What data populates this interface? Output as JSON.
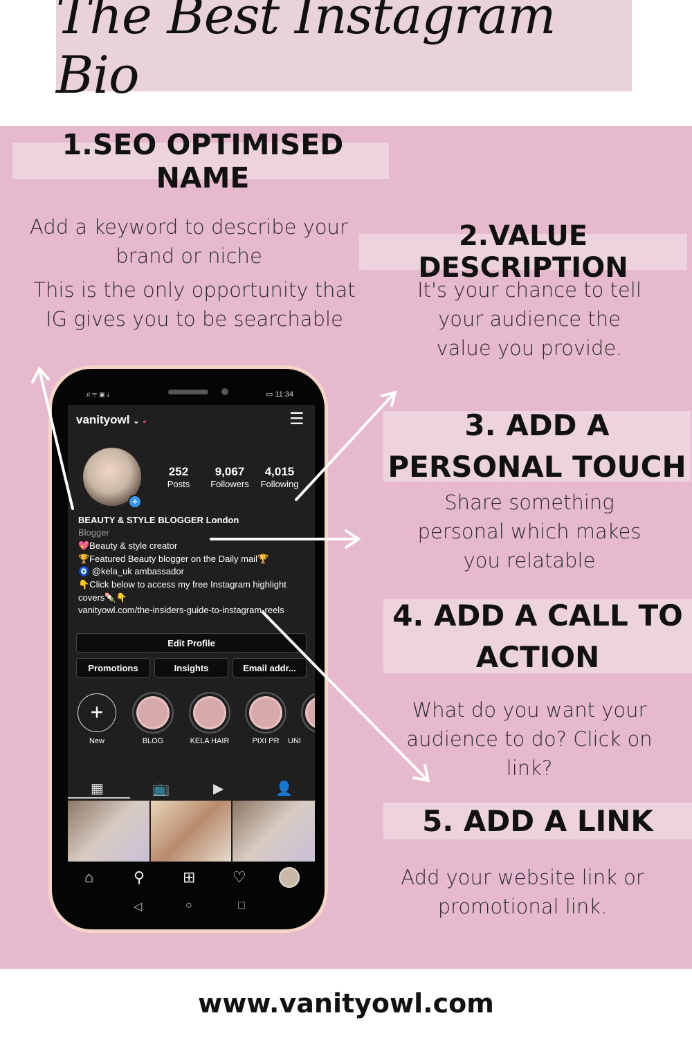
{
  "title": "The Best Instagram Bio",
  "sections": [
    {
      "heading": "1.SEO OPTIMISED NAME",
      "text": [
        "Add a keyword to describe your brand or niche",
        "This is the only opportunity that IG gives you to be searchable"
      ]
    },
    {
      "heading": "2.VALUE DESCRIPTION",
      "text": [
        "It's your chance to tell your audience the value you provide."
      ]
    },
    {
      "heading": "3. ADD A PERSONAL TOUCH",
      "text": [
        "Share something personal which makes you relatable"
      ]
    },
    {
      "heading": "4. ADD A CALL TO ACTION",
      "text": [
        "What do you want your audience to do? Click on link?"
      ]
    },
    {
      "heading": "5. ADD A LINK",
      "text": [
        "Add your website link or promotional link."
      ]
    }
  ],
  "footer": "www.vanityowl.com",
  "phone": {
    "time": "11:34",
    "username": "vanityowl",
    "stats": [
      {
        "value": "252",
        "label": "Posts"
      },
      {
        "value": "9,067",
        "label": "Followers"
      },
      {
        "value": "4,015",
        "label": "Following"
      }
    ],
    "bio": {
      "name": "BEAUTY & STYLE BLOGGER London",
      "category": "Blogger",
      "lines": [
        "💖Beauty & style creator",
        "🏆Featured Beauty blogger on the Daily mail🏆",
        "🧿 @kela_uk ambassador",
        "👇Click below to access my free Instagram highlight covers🍡👇"
      ],
      "link": "vanityowl.com/the-insiders-guide-to-instagram-reels"
    },
    "buttons": {
      "edit": "Edit Profile",
      "promotions": "Promotions",
      "insights": "Insights",
      "email": "Email addr..."
    },
    "highlights": [
      "New",
      "BLOG",
      "KELA HAIR",
      "PIXI PR",
      "UNI"
    ]
  }
}
